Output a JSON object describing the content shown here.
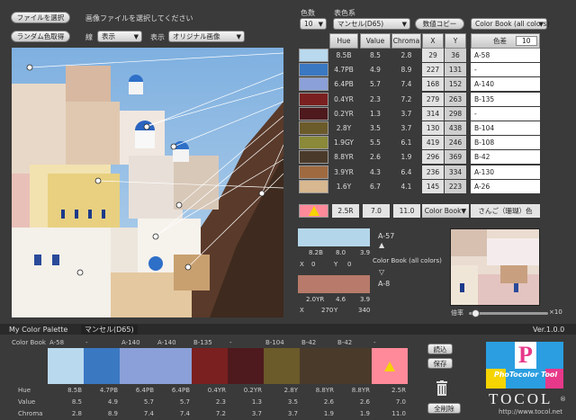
{
  "toolbar": {
    "select_file_label": "ファイルを選択",
    "file_prompt": "画像ファイルを選択してください",
    "random_label": "ランダム色取得",
    "line_label": "線",
    "line_value": "表示",
    "display_label": "表示",
    "display_value": "オリジナル画像",
    "color_count_label": "色数",
    "color_count_value": "10",
    "color_system_label": "表色系",
    "color_system_value": "マンセル(D65)",
    "copy_values_label": "数値コピー",
    "book_select_value": "Color Book (all colors)"
  },
  "table": {
    "headers": [
      "Hue",
      "Value",
      "Chroma",
      "X",
      "Y"
    ],
    "delta_label": "色差",
    "delta_value": "10",
    "rows": [
      {
        "color": "#b9d9ee",
        "hue": "8.5B",
        "value": "8.5",
        "chroma": "2.8",
        "x": "29",
        "y": "36",
        "name": "A-58"
      },
      {
        "color": "#3a78c2",
        "hue": "4.7PB",
        "value": "4.9",
        "chroma": "8.9",
        "x": "227",
        "y": "131",
        "name": "-"
      },
      {
        "color": "#8ba0d8",
        "hue": "6.4PB",
        "value": "5.7",
        "chroma": "7.4",
        "x": "168",
        "y": "152",
        "name": "A-140"
      },
      {
        "color": "#7a2020",
        "hue": "0.4YR",
        "value": "2.3",
        "chroma": "7.2",
        "x": "279",
        "y": "263",
        "name": "B-135"
      },
      {
        "color": "#4e1a1e",
        "hue": "0.2YR",
        "value": "1.3",
        "chroma": "3.7",
        "x": "314",
        "y": "298",
        "name": "-"
      },
      {
        "color": "#6b5a2a",
        "hue": "2.8Y",
        "value": "3.5",
        "chroma": "3.7",
        "x": "130",
        "y": "438",
        "name": "B-104"
      },
      {
        "color": "#8a8a3a",
        "hue": "1.9GY",
        "value": "5.5",
        "chroma": "6.1",
        "x": "419",
        "y": "246",
        "name": "B-108"
      },
      {
        "color": "#4a3a2a",
        "hue": "8.8YR",
        "value": "2.6",
        "chroma": "1.9",
        "x": "296",
        "y": "369",
        "name": "B-42"
      },
      {
        "color": "#a06a40",
        "hue": "3.9YR",
        "value": "4.3",
        "chroma": "6.4",
        "x": "236",
        "y": "334",
        "name": "A-130"
      },
      {
        "color": "#d8b890",
        "hue": "1.6Y",
        "value": "6.7",
        "chroma": "4.1",
        "x": "145",
        "y": "223",
        "name": "A-26"
      }
    ],
    "selected": {
      "color": "#ff8a9a",
      "hue": "2.5R",
      "value": "7.0",
      "chroma": "11.0",
      "book_label": "Color Book▼",
      "name": "さんご（珊瑚）色"
    }
  },
  "compare": {
    "top": {
      "name": "A-57",
      "color": "#b4d6ea",
      "v1": "8.2B",
      "v2": "8.0",
      "v3": "3.9",
      "xl": "X",
      "xv": "0",
      "yl": "Y",
      "yv": "0"
    },
    "book_text": "Color Book (all colors)",
    "bottom": {
      "name": "A-8",
      "color": "#b87a6a",
      "v1": "2.0YR",
      "v2": "4.6",
      "v3": "3.9",
      "xl": "X",
      "xv": "270",
      "yl": "Y",
      "yv": "340"
    },
    "zoom_label": "倍率",
    "zoom_max": "×10",
    "zoom_level": 0.08
  },
  "palette": {
    "title": "My Color Palette",
    "system": "マンセル(D65)",
    "version": "Ver.1.0.0",
    "row_labels": {
      "book": "Color Book",
      "hue": "Hue",
      "value": "Value",
      "chroma": "Chroma"
    },
    "swatches": [
      {
        "color": "#b9d9ee",
        "book": "A-58",
        "hue": "8.5B",
        "value": "8.5",
        "chroma": "2.8"
      },
      {
        "color": "#3a78c2",
        "book": "-",
        "hue": "4.7PB",
        "value": "4.9",
        "chroma": "8.9"
      },
      {
        "color": "#8ba0d8",
        "book": "A-140",
        "hue": "6.4PB",
        "value": "5.7",
        "chroma": "7.4"
      },
      {
        "color": "#8ba0d8",
        "book": "A-140",
        "hue": "6.4PB",
        "value": "5.7",
        "chroma": "7.4"
      },
      {
        "color": "#7a2020",
        "book": "B-135",
        "hue": "0.4YR",
        "value": "2.3",
        "chroma": "7.2"
      },
      {
        "color": "#4e1a1e",
        "book": "-",
        "hue": "0.2YR",
        "value": "1.3",
        "chroma": "3.7"
      },
      {
        "color": "#6b5a2a",
        "book": "B-104",
        "hue": "2.8Y",
        "value": "3.5",
        "chroma": "3.7"
      },
      {
        "color": "#4a3a2a",
        "book": "B-42",
        "hue": "8.8YR",
        "value": "2.6",
        "chroma": "1.9"
      },
      {
        "color": "#4a3a2a",
        "book": "B-42",
        "hue": "8.8YR",
        "value": "2.6",
        "chroma": "1.9"
      },
      {
        "color": "#ff8a9a",
        "book": "-",
        "hue": "2.5R",
        "value": "7.0",
        "chroma": "11.0",
        "warn": true
      }
    ],
    "load_label": "読込",
    "save_label": "保存",
    "delete_all_label": "全削除"
  },
  "brand": {
    "p_letter": "P",
    "logo_text": "PhoTocolor Tool",
    "tocol": "TOCOL",
    "reg": "®",
    "url": "http://www.tocol.net"
  }
}
